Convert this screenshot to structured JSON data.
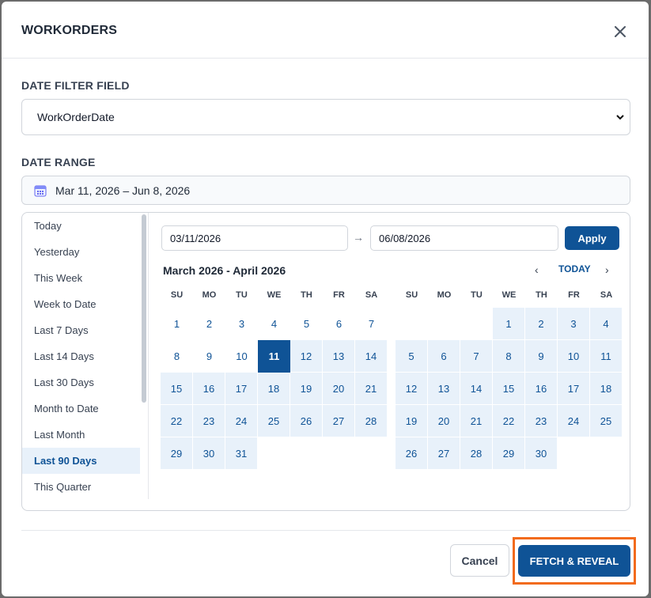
{
  "modal": {
    "title": "WORKORDERS",
    "close_icon": "close-icon"
  },
  "filter_field": {
    "label": "DATE FILTER FIELD",
    "value": "WorkOrderDate"
  },
  "date_range": {
    "label": "DATE RANGE",
    "display": "Mar 11, 2026 – Jun 8, 2026",
    "icon": "calendar-icon"
  },
  "presets": [
    {
      "label": "Today"
    },
    {
      "label": "Yesterday"
    },
    {
      "label": "This Week"
    },
    {
      "label": "Week to Date"
    },
    {
      "label": "Last 7 Days"
    },
    {
      "label": "Last 14 Days"
    },
    {
      "label": "Last 30 Days"
    },
    {
      "label": "Month to Date"
    },
    {
      "label": "Last Month"
    },
    {
      "label": "Last 90 Days",
      "active": true
    },
    {
      "label": "This Quarter"
    }
  ],
  "calendar": {
    "start_input": "03/11/2026",
    "end_input": "06/08/2026",
    "arrow": "→",
    "apply_label": "Apply",
    "title": "March 2026 - April 2026",
    "prev": "‹",
    "today_label": "TODAY",
    "next": "›",
    "weekdays": [
      "SU",
      "MO",
      "TU",
      "WE",
      "TH",
      "FR",
      "SA"
    ],
    "months": [
      {
        "name": "March 2026",
        "weeks": [
          [
            {
              "d": "1"
            },
            {
              "d": "2"
            },
            {
              "d": "3"
            },
            {
              "d": "4"
            },
            {
              "d": "5"
            },
            {
              "d": "6"
            },
            {
              "d": "7"
            }
          ],
          [
            {
              "d": "8"
            },
            {
              "d": "9"
            },
            {
              "d": "10"
            },
            {
              "d": "11",
              "sel": true
            },
            {
              "d": "12",
              "r": true
            },
            {
              "d": "13",
              "r": true
            },
            {
              "d": "14",
              "r": true
            }
          ],
          [
            {
              "d": "15",
              "r": true
            },
            {
              "d": "16",
              "r": true
            },
            {
              "d": "17",
              "r": true
            },
            {
              "d": "18",
              "r": true
            },
            {
              "d": "19",
              "r": true
            },
            {
              "d": "20",
              "r": true
            },
            {
              "d": "21",
              "r": true
            }
          ],
          [
            {
              "d": "22",
              "r": true
            },
            {
              "d": "23",
              "r": true
            },
            {
              "d": "24",
              "r": true
            },
            {
              "d": "25",
              "r": true
            },
            {
              "d": "26",
              "r": true
            },
            {
              "d": "27",
              "r": true
            },
            {
              "d": "28",
              "r": true
            }
          ],
          [
            {
              "d": "29",
              "r": true
            },
            {
              "d": "30",
              "r": true
            },
            {
              "d": "31",
              "r": true
            },
            {
              "d": ""
            },
            {
              "d": ""
            },
            {
              "d": ""
            },
            {
              "d": ""
            }
          ]
        ]
      },
      {
        "name": "April 2026",
        "weeks": [
          [
            {
              "d": ""
            },
            {
              "d": ""
            },
            {
              "d": ""
            },
            {
              "d": "1",
              "r": true
            },
            {
              "d": "2",
              "r": true
            },
            {
              "d": "3",
              "r": true
            },
            {
              "d": "4",
              "r": true
            }
          ],
          [
            {
              "d": "5",
              "r": true
            },
            {
              "d": "6",
              "r": true
            },
            {
              "d": "7",
              "r": true
            },
            {
              "d": "8",
              "r": true
            },
            {
              "d": "9",
              "r": true
            },
            {
              "d": "10",
              "r": true
            },
            {
              "d": "11",
              "r": true
            }
          ],
          [
            {
              "d": "12",
              "r": true
            },
            {
              "d": "13",
              "r": true
            },
            {
              "d": "14",
              "r": true
            },
            {
              "d": "15",
              "r": true
            },
            {
              "d": "16",
              "r": true
            },
            {
              "d": "17",
              "r": true
            },
            {
              "d": "18",
              "r": true
            }
          ],
          [
            {
              "d": "19",
              "r": true
            },
            {
              "d": "20",
              "r": true
            },
            {
              "d": "21",
              "r": true
            },
            {
              "d": "22",
              "r": true
            },
            {
              "d": "23",
              "r": true
            },
            {
              "d": "24",
              "r": true
            },
            {
              "d": "25",
              "r": true
            }
          ],
          [
            {
              "d": "26",
              "r": true
            },
            {
              "d": "27",
              "r": true
            },
            {
              "d": "28",
              "r": true
            },
            {
              "d": "29",
              "r": true
            },
            {
              "d": "30",
              "r": true
            },
            {
              "d": ""
            },
            {
              "d": ""
            }
          ]
        ]
      }
    ]
  },
  "footer": {
    "cancel_label": "Cancel",
    "fetch_label": "FETCH & REVEAL"
  },
  "colors": {
    "primary": "#0f5396",
    "range_bg": "#e8f1fa",
    "highlight_border": "#f26b1d"
  }
}
